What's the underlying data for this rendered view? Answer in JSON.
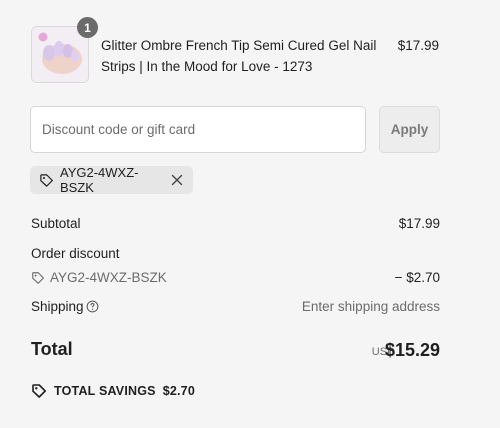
{
  "product": {
    "quantity": "1",
    "title": "Glitter Ombre French Tip Semi Cured Gel Nail Strips | In the Mood for Love - 1273",
    "price": "$17.99",
    "image_description": "nail-strips-thumbnail"
  },
  "discount": {
    "placeholder": "Discount code or gift card",
    "value": "",
    "apply_label": "Apply",
    "applied_code": "AYG2-4WXZ-BSZK"
  },
  "summary": {
    "subtotal_label": "Subtotal",
    "subtotal_value": "$17.99",
    "order_discount_label": "Order discount",
    "discount_code": "AYG2-4WXZ-BSZK",
    "discount_value": "− $2.70",
    "shipping_label": "Shipping",
    "shipping_value": "Enter shipping address",
    "total_label": "Total",
    "currency": "USD",
    "total_value": "$15.29",
    "savings_label": "TOTAL SAVINGS",
    "savings_value": "$2.70"
  },
  "icons": {
    "tag": "tag-icon",
    "remove": "close-icon",
    "help": "question-circle-icon",
    "savings": "tag-icon"
  },
  "colors": {
    "background": "#f5f5f5",
    "badge": "#6b6b6b",
    "muted_text": "#6b6b6b",
    "chip_bg": "#e6e6e6"
  }
}
